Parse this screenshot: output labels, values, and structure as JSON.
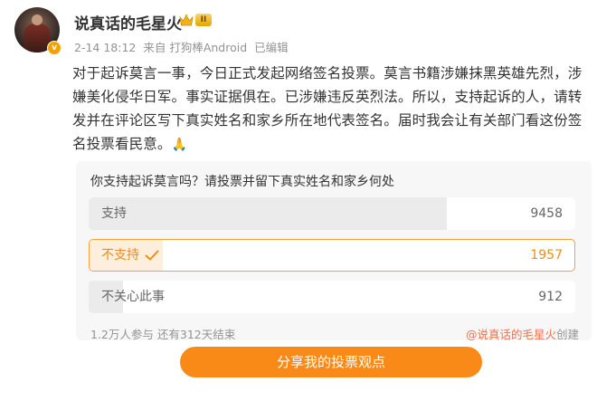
{
  "user": {
    "name": "说真话的毛星火",
    "level_badge": "II",
    "verified_mark": "v"
  },
  "meta": {
    "date": "2-14 18:12",
    "source": "来自 打狗棒Android",
    "edited": "已编辑"
  },
  "post": {
    "text": "对于起诉莫言一事，今日正式发起网络签名投票。莫言书籍涉嫌抹黑英雄先烈，涉嫌美化侵华日军。事实证据俱在。已涉嫌违反英烈法。所以，支持起诉的人，请转发并在评论区写下真实姓名和家乡所在地代表签名。届时我会让有关部门看这份签名投票看民意。",
    "emoji": "🙏"
  },
  "poll": {
    "question": "你支持起诉莫言吗？请投票并留下真实姓名和家乡何处",
    "options": [
      {
        "label": "支持",
        "count": "9458",
        "share": 0.736
      },
      {
        "label": "不支持",
        "count": "1957",
        "share": 0.152,
        "selected": true
      },
      {
        "label": "不关心此事",
        "count": "912",
        "share": 0.071
      }
    ],
    "participants": "1.2万人参与",
    "remaining": "还有312天结束",
    "creator_handle": "@说真话的毛星火",
    "creator_suffix": "创建",
    "share_button": "分享我的投票观点"
  },
  "colors": {
    "accent": "#fa8a18",
    "selected_border": "#f7a236",
    "selected_text": "#f28b1a",
    "link": "#eb7350"
  },
  "icons": [
    "crown-icon",
    "level-badge-icon",
    "verified-icon",
    "check-icon"
  ]
}
